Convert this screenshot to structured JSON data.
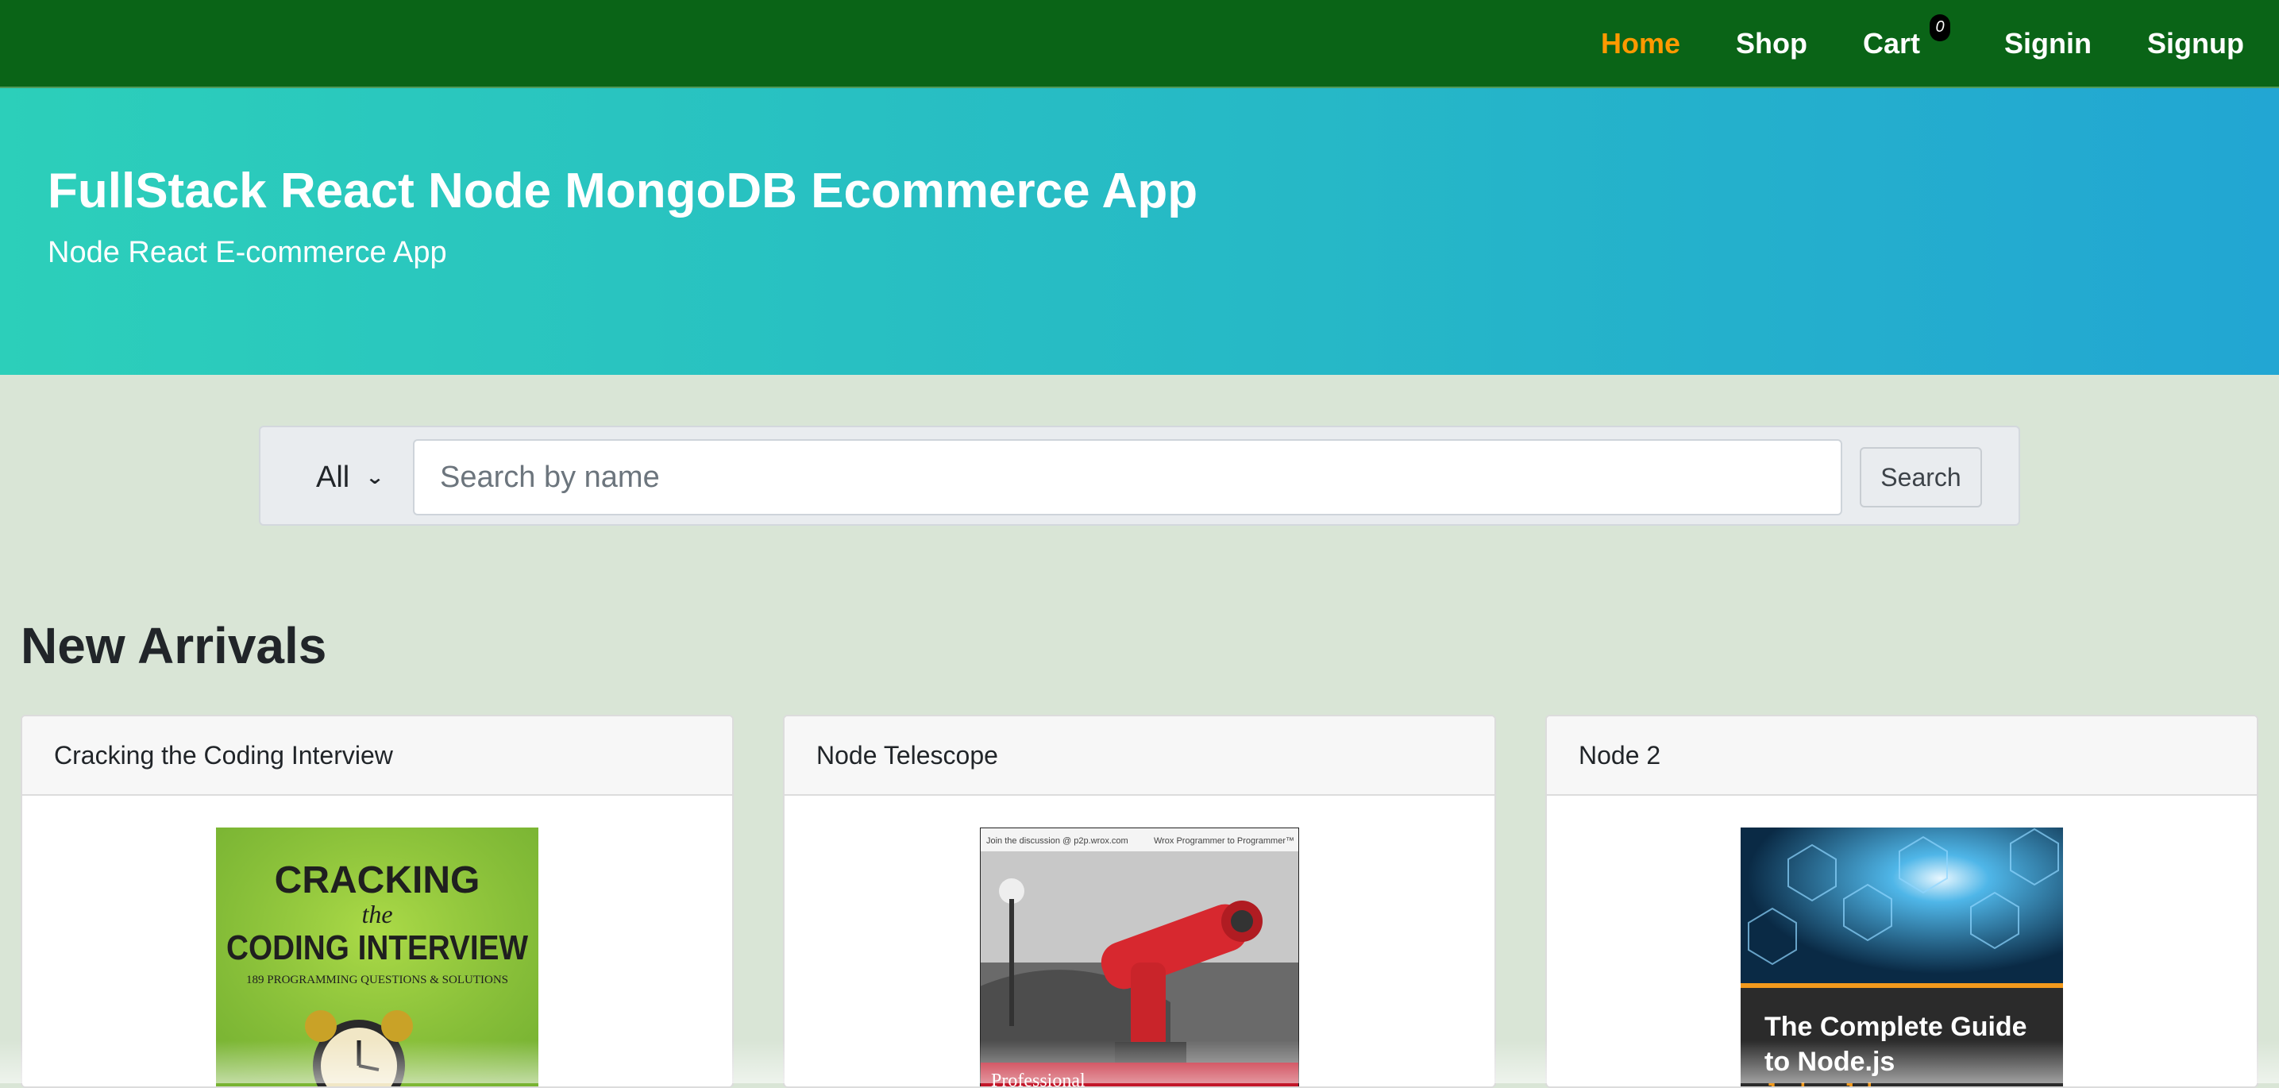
{
  "nav": {
    "items": [
      {
        "label": "Home",
        "active": true
      },
      {
        "label": "Shop"
      },
      {
        "label": "Cart",
        "badge": "0"
      },
      {
        "label": "Signin"
      },
      {
        "label": "Signup"
      }
    ]
  },
  "jumbotron": {
    "title": "FullStack React Node MongoDB Ecommerce App",
    "subtitle": "Node React E-commerce App"
  },
  "search": {
    "category": "All",
    "placeholder": "Search by name",
    "value": "",
    "button_label": "Search"
  },
  "new_arrivals": {
    "heading": "New Arrivals",
    "products": [
      {
        "name": "Cracking the Coding Interview",
        "cover": {
          "line1": "CRACKING",
          "line2": "the",
          "line3": "CODING INTERVIEW",
          "line4": "189 PROGRAMMING QUESTIONS & SOLUTIONS"
        }
      },
      {
        "name": "Node Telescope",
        "cover": {
          "top_left": "Join the discussion @ p2p.wrox.com",
          "top_right": "Wrox Programmer to Programmer™",
          "bottom": "Professional"
        }
      },
      {
        "name": "Node 2",
        "cover": {
          "title_line1": "The Complete Guide",
          "title_line2": "to Node.js",
          "author": "Joshua Johanan"
        }
      }
    ]
  },
  "colors": {
    "navbar": "#0a6417",
    "nav_active": "#ff9900",
    "jumbotron_start": "#2ccfba",
    "jumbotron_end": "#22a6d3",
    "page_bg": "#d9e5d6"
  }
}
